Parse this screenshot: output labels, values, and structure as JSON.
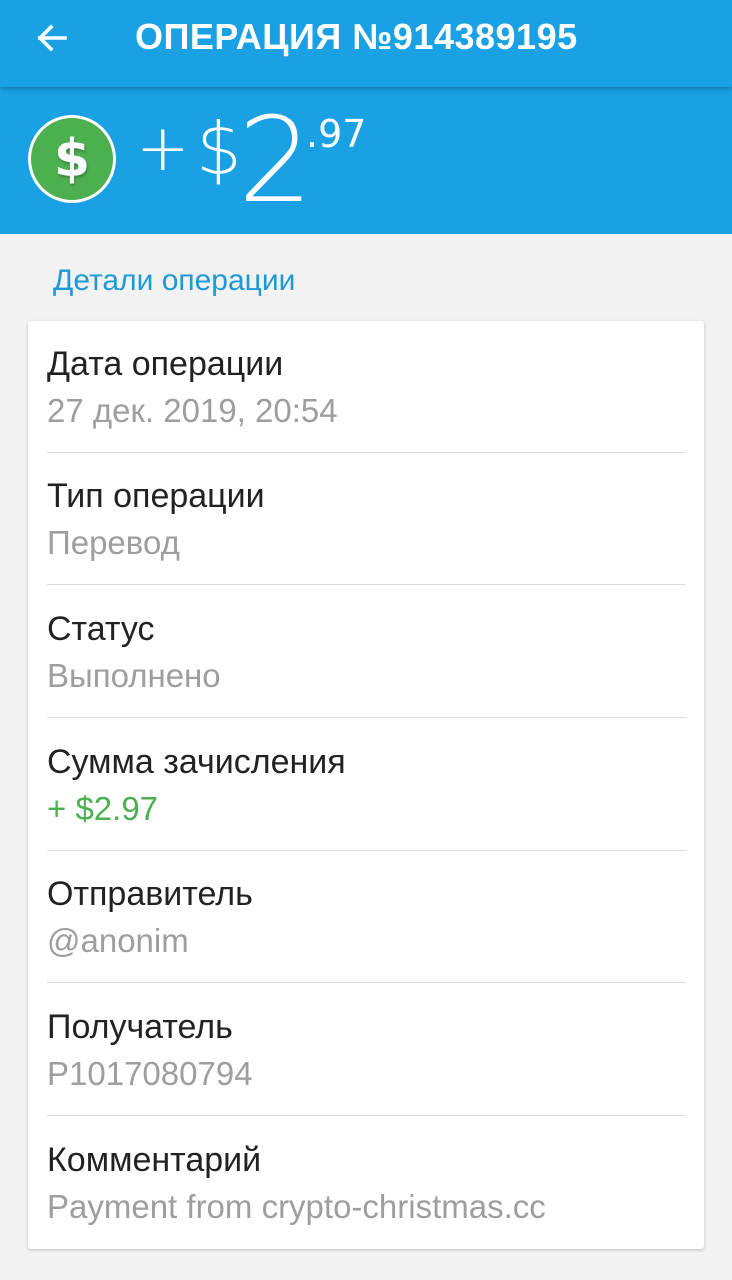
{
  "header": {
    "back_icon": "arrow-left-icon",
    "title": "ОПЕРАЦИЯ №914389195",
    "background": "#1aa1e4"
  },
  "amount": {
    "icon": "dollar-coin-icon",
    "icon_symbol": "$",
    "sign": "+",
    "currency": "$",
    "integer": "2",
    "fraction": ".97",
    "icon_color": "#4caf50"
  },
  "details": {
    "section_title": "Детали операции",
    "rows": [
      {
        "label": "Дата операции",
        "value": "27 дек. 2019, 20:54"
      },
      {
        "label": "Тип операции",
        "value": "Перевод"
      },
      {
        "label": "Статус",
        "value": "Выполнено"
      },
      {
        "label": "Сумма зачисления",
        "value": "+ $2.97",
        "value_color": "#4caf50"
      },
      {
        "label": "Отправитель",
        "value": "@anonim"
      },
      {
        "label": "Получатель",
        "value": "P1017080794"
      },
      {
        "label": "Комментарий",
        "value": "Payment from crypto-christmas.cc"
      }
    ]
  }
}
